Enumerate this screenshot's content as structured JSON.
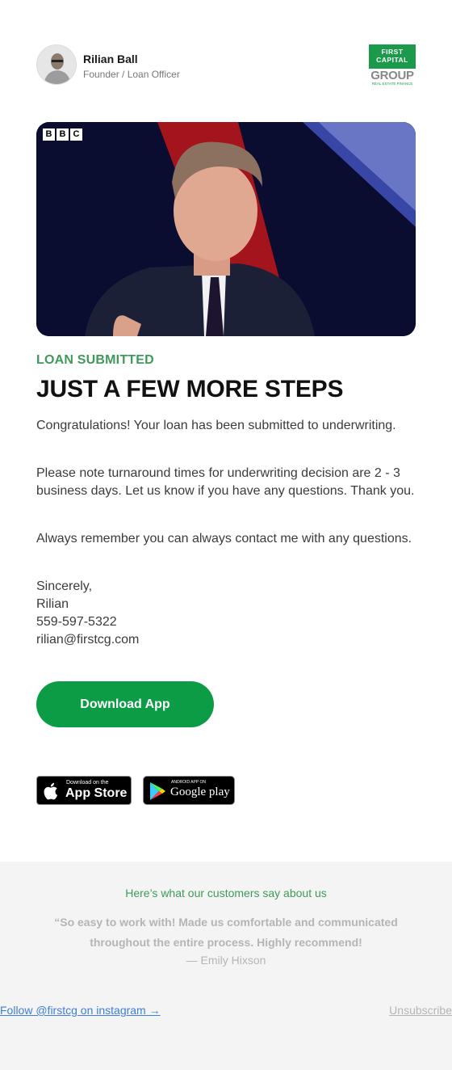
{
  "header": {
    "sender_name": "Rilian Ball",
    "sender_role": "Founder / Loan Officer",
    "logo": {
      "line1": "FIRST",
      "line2": "CAPITAL",
      "line3": "GROUP",
      "line4": "REAL ESTATE FINANCE"
    }
  },
  "hero": {
    "broadcaster_mark": [
      "B",
      "B",
      "C"
    ]
  },
  "content": {
    "eyebrow": "LOAN SUBMITTED",
    "headline": "JUST A FEW MORE STEPS",
    "paragraph1": "Congratulations! Your loan has been submitted to underwriting.",
    "paragraph2": "Please note turnaround times for underwriting decision are 2 - 3 business days. Let us know if you have any questions. Thank you.",
    "paragraph3": "Always remember you can always contact me with any questions.",
    "signoff": "Sincerely,",
    "sig_name": "Rilian",
    "sig_phone": "559-597-5322",
    "sig_email": "rilian@firstcg.com"
  },
  "cta": {
    "download_label": "Download App"
  },
  "stores": {
    "apple_small": "Download on the",
    "apple_big": "App Store",
    "google_small": "ANDROID APP ON",
    "google_big": "Google play"
  },
  "footer": {
    "title": "Here’s what our customers say about us",
    "quote": "“So easy to work with! Made us comfortable and communicated throughout the entire process. Highly recommend!",
    "author": "— Emily Hixson",
    "follow_link": "Follow @firstcg on instagram →",
    "unsubscribe": "Unsubscribe"
  },
  "colors": {
    "accent_green": "#0b9c45",
    "eyebrow_green": "#3f9a5a",
    "link_blue": "#3d7fd9",
    "footer_bg": "#f4f4f4"
  }
}
